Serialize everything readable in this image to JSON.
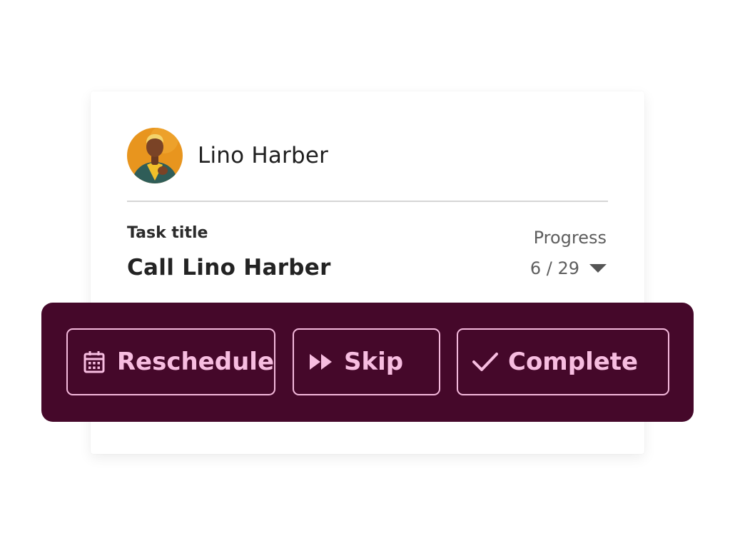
{
  "contact": {
    "name": "Lino Harber",
    "avatar_alt": "avatar"
  },
  "task": {
    "label": "Task title",
    "title": "Call Lino Harber"
  },
  "progress": {
    "label": "Progress",
    "value": "6 / 29",
    "current": 6,
    "total": 29,
    "dropdown_icon": "caret-down-icon"
  },
  "actions": {
    "reschedule_label": "Reschedule",
    "reschedule_icon": "calendar-icon",
    "skip_label": "Skip",
    "skip_icon": "fast-forward-icon",
    "complete_label": "Complete",
    "complete_icon": "check-icon"
  },
  "colors": {
    "action_bar_bg": "#45082a",
    "action_accent": "#f7bde0",
    "avatar_bg": "#e8951e",
    "text_primary": "#232323",
    "text_muted": "#5e5e5e"
  }
}
